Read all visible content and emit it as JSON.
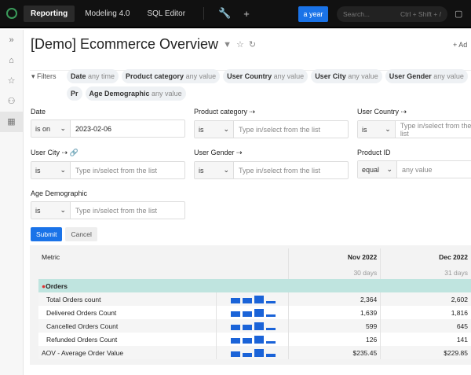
{
  "topbar": {
    "tabs": [
      "Reporting",
      "Modeling 4.0",
      "SQL Editor"
    ],
    "period": "a year",
    "search_placeholder": "Search...",
    "search_shortcut": "Ctrl + Shift + /"
  },
  "title": "[Demo] Ecommerce Overview",
  "add_label": "+ Ad",
  "filters": {
    "label": "Filters",
    "chips": [
      {
        "name": "Date",
        "value": "any time"
      },
      {
        "name": "Product category",
        "value": "any value"
      },
      {
        "name": "User Country",
        "value": "any value"
      },
      {
        "name": "User City",
        "value": "any value"
      },
      {
        "name": "User Gender",
        "value": "any value"
      },
      {
        "name": "Pr",
        "value": ""
      },
      {
        "name": "Age Demographic",
        "value": "any value"
      }
    ]
  },
  "form": {
    "date": {
      "label": "Date",
      "op": "is on",
      "value": "2023-02-06"
    },
    "product_category": {
      "label": "Product category",
      "op": "is",
      "placeholder": "Type in/select from the list"
    },
    "user_country": {
      "label": "User Country",
      "op": "is",
      "placeholder": "Type in/select from the list"
    },
    "user_city": {
      "label": "User City",
      "op": "is",
      "placeholder": "Type in/select from the list"
    },
    "user_gender": {
      "label": "User Gender",
      "op": "is",
      "placeholder": "Type in/select from the list"
    },
    "product_id": {
      "label": "Product ID",
      "op": "equal",
      "placeholder": "any value"
    },
    "age": {
      "label": "Age Demographic",
      "op": "is",
      "placeholder": "Type in/select from the list"
    },
    "submit": "Submit",
    "cancel": "Cancel"
  },
  "table": {
    "metric_header": "Metric",
    "columns": [
      {
        "label": "Nov 2022",
        "sub": "30 days"
      },
      {
        "label": "Dec 2022",
        "sub": "31 days"
      }
    ],
    "group": "Orders",
    "rows": [
      {
        "name": "Total Orders count",
        "values": [
          "2,364",
          "2,602"
        ]
      },
      {
        "name": "Delivered Orders Count",
        "values": [
          "1,639",
          "1,816"
        ]
      },
      {
        "name": "Cancelled Orders Count",
        "values": [
          "599",
          "645"
        ]
      },
      {
        "name": "Refunded Orders Count",
        "values": [
          "126",
          "141"
        ]
      },
      {
        "name": "AOV - Average Order Value",
        "values": [
          "$235.45",
          "$229.85"
        ]
      }
    ]
  },
  "colors": {
    "accent": "#1a73e8",
    "group_bg": "#bfe4df"
  }
}
